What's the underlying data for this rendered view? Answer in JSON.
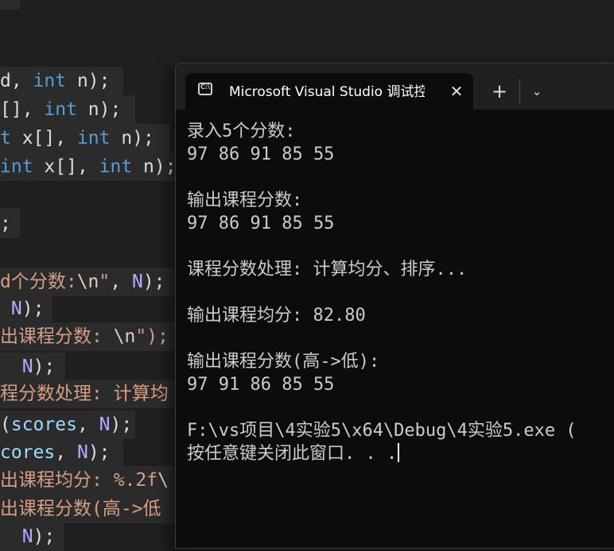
{
  "editor": {
    "lines": [
      [
        "",
        "",
        "d",
        "",
        ", ",
        "int",
        " n);"
      ],
      [
        "",
        "",
        "[]",
        "",
        ", ",
        "int",
        " n);"
      ],
      [
        "",
        "t",
        " x[]",
        "",
        ", ",
        "int",
        " n);"
      ],
      [
        "",
        "int",
        " x[]",
        "",
        ", ",
        "int",
        " n);"
      ],
      [
        "",
        "",
        ";",
        "",
        "",
        "",
        ""
      ],
      [
        "d个分数:",
        "\\n",
        "\"",
        "",
        ", ",
        "N",
        ");"
      ],
      [
        "",
        "",
        "",
        " ",
        "",
        "N",
        ");"
      ],
      [
        "出课程分数: ",
        "\\n",
        "\");",
        "",
        "",
        "",
        ""
      ],
      [
        "",
        "",
        "",
        "  ",
        "",
        "N",
        ");"
      ],
      [
        "程分数处理: 计算均",
        "",
        "",
        "",
        "",
        "",
        ""
      ],
      [
        "",
        "",
        "(",
        "scores",
        ", ",
        "N",
        ");"
      ],
      [
        "",
        "",
        "",
        "cores",
        ", ",
        "N",
        ");"
      ],
      [
        "出课程均分: %.2f",
        "\\",
        "",
        "",
        "",
        "",
        ""
      ],
      [
        "出课程分数(高->低",
        "",
        "",
        "",
        "",
        "",
        ""
      ],
      [
        "",
        "",
        "",
        "  ",
        "",
        "N",
        ");"
      ]
    ]
  },
  "terminal": {
    "tab_title": "Microsoft Visual Studio 调试控制台",
    "tab_icon": "console-icon",
    "close_glyph": "✕",
    "new_tab_glyph": "+",
    "dropdown_glyph": "⌄",
    "output": [
      "录入5个分数:",
      "97 86 91 85 55",
      "",
      "输出课程分数:",
      "97 86 91 85 55",
      "",
      "课程分数处理: 计算均分、排序...",
      "",
      "输出课程均分: 82.80",
      "",
      "输出课程分数(高->低):",
      "97 91 86 85 55",
      "",
      "F:\\vs项目\\4实验5\\x64\\Debug\\4实验5.exe (",
      "按任意键关闭此窗口. . ."
    ]
  }
}
